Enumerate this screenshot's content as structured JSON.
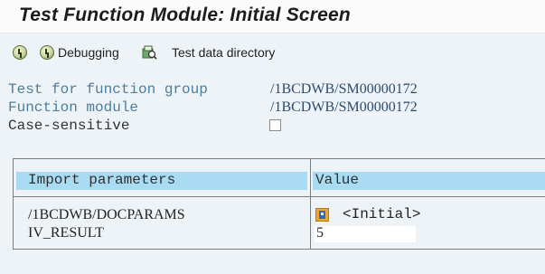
{
  "window": {
    "title": "Test Function Module: Initial Screen"
  },
  "toolbar": {
    "execute_icon": "execute-icon",
    "debugging_label": "Debugging",
    "test_data_directory_label": "Test data directory"
  },
  "fields": {
    "function_group_label": "Test for function group",
    "function_group_value": "/1BCDWB/SM00000172",
    "function_module_label": "Function module",
    "function_module_value": "/1BCDWB/SM00000172",
    "case_sensitive_label": "Case-sensitive",
    "case_sensitive_checked": false
  },
  "params_table": {
    "headers": [
      "Import parameters",
      "Value"
    ],
    "rows": [
      {
        "name": "/1BCDWB/DOCPARAMS",
        "value": "<Initial>",
        "value_icon": "structure-icon"
      },
      {
        "name": "IV_RESULT",
        "value": "5"
      }
    ]
  },
  "colors": {
    "label_blue": "#4c7e9a",
    "value_blue": "#2c4c6e",
    "header_bg": "#a9dcf3",
    "background": "#eef3f8"
  }
}
